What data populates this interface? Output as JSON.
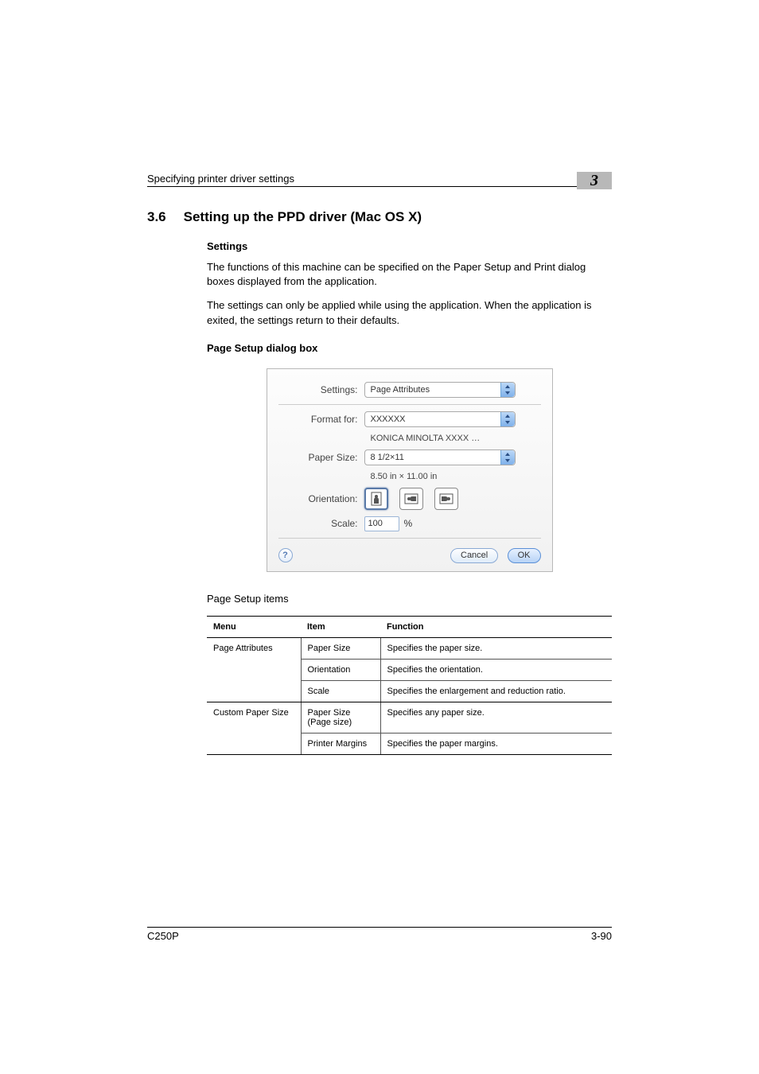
{
  "header": {
    "running_title": "Specifying printer driver settings",
    "chapter_badge": "3"
  },
  "section": {
    "number": "3.6",
    "title": "Setting up the PPD driver (Mac OS X)"
  },
  "subheads": {
    "settings": "Settings",
    "page_setup_box": "Page Setup dialog box"
  },
  "paragraphs": {
    "p1": "The functions of this machine can be specified on the Paper Setup and Print dialog boxes displayed from the application.",
    "p2": "The settings can only be applied while using the application. When the application is exited, the settings return to their defaults."
  },
  "dialog": {
    "labels": {
      "settings": "Settings:",
      "format_for": "Format for:",
      "paper_size": "Paper Size:",
      "orientation": "Orientation:",
      "scale": "Scale:",
      "percent": "%"
    },
    "values": {
      "settings": "Page Attributes",
      "format_for": "XXXXXX",
      "format_for_sub": "KONICA MINOLTA XXXX …",
      "paper_size": "8 1/2×11",
      "paper_size_sub": "8.50 in × 11.00 in",
      "scale": "100"
    },
    "buttons": {
      "help": "?",
      "cancel": "Cancel",
      "ok": "OK"
    }
  },
  "table": {
    "caption": "Page Setup items",
    "headers": {
      "menu": "Menu",
      "item": "Item",
      "func": "Function"
    },
    "rows": [
      {
        "menu": "Page Attributes",
        "item": "Paper Size",
        "func": "Specifies the paper size."
      },
      {
        "menu": "",
        "item": "Orientation",
        "func": "Specifies the orientation."
      },
      {
        "menu": "",
        "item": "Scale",
        "func": "Specifies the enlargement and reduction ratio."
      },
      {
        "menu": "Custom Paper Size",
        "item": "Paper Size (Page size)",
        "func": "Specifies any paper size."
      },
      {
        "menu": "",
        "item": "Printer Margins",
        "func": "Specifies the paper margins."
      }
    ]
  },
  "footer": {
    "model": "C250P",
    "page": "3-90"
  }
}
